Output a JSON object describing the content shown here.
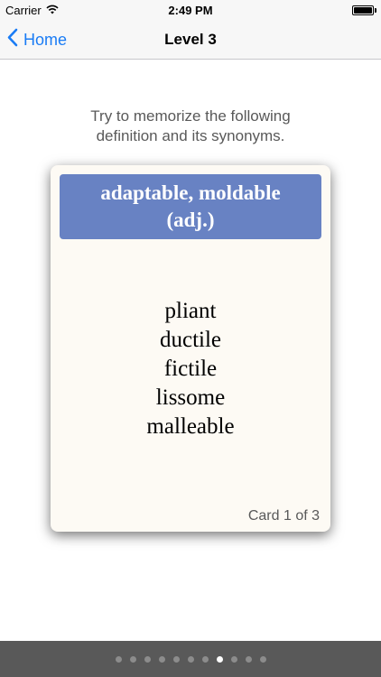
{
  "status_bar": {
    "carrier": "Carrier",
    "time": "2:49 PM",
    "wifi_icon": "wifi-icon",
    "battery_level": 1.0
  },
  "nav": {
    "back_label": "Home",
    "back_icon": "chevron-left-icon",
    "title": "Level 3"
  },
  "instruction": {
    "line1": "Try to memorize the following",
    "line2": "definition and its synonyms."
  },
  "card": {
    "definition_line1": "adaptable, moldable",
    "definition_line2": "(adj.)",
    "synonyms": [
      "pliant",
      "ductile",
      "fictile",
      "lissome",
      "malleable"
    ],
    "counter": "Card 1 of 3"
  },
  "pager": {
    "total_pages": 11,
    "current_page": 8
  },
  "colors": {
    "accent": "#1a7cf5",
    "card_header": "#6882c3",
    "card_background": "#fdfaf4",
    "bottom_bar": "#595959"
  }
}
